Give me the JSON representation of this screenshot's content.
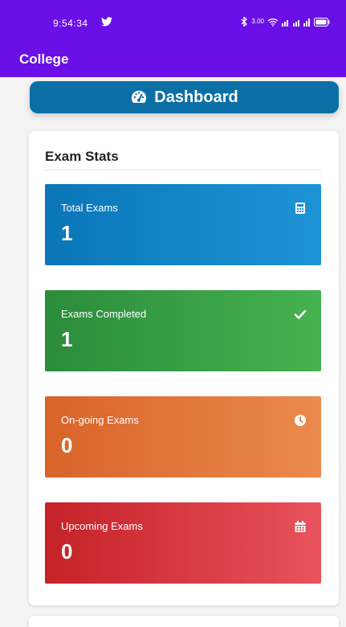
{
  "status_bar": {
    "time": "9:54:34",
    "icons": [
      "twitter-icon",
      "bluetooth-icon",
      "data-speed-icon",
      "wifi-icon",
      "signal-icon",
      "battery-icon"
    ],
    "speed_text": "3.00"
  },
  "app_bar": {
    "title": "College"
  },
  "dashboard_button": {
    "label": "Dashboard",
    "icon": "speedometer-icon"
  },
  "exam_stats": {
    "title": "Exam Stats",
    "items": [
      {
        "label": "Total Exams",
        "value": "1",
        "icon": "calculator-icon",
        "color": "#1d94d6"
      },
      {
        "label": "Exams Completed",
        "value": "1",
        "icon": "check-icon",
        "color": "#46b24f"
      },
      {
        "label": "On-going Exams",
        "value": "0",
        "icon": "clock-icon",
        "color": "#ea8a4c"
      },
      {
        "label": "Upcoming Exams",
        "value": "0",
        "icon": "calendar-icon",
        "color": "#e8535c"
      }
    ]
  }
}
